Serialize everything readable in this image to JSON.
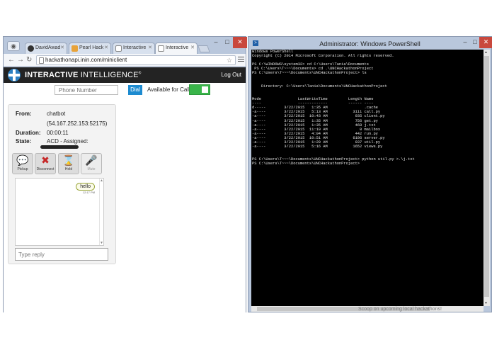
{
  "browser": {
    "tabs": [
      {
        "label": "DavidAwad",
        "color": "#333333"
      },
      {
        "label": "Pearl Hack",
        "color": "#e8a33a"
      },
      {
        "label": "Interactive",
        "color": "#888888"
      },
      {
        "label": "Interactive",
        "color": "#888888"
      }
    ],
    "url": "hackathonapi.inin.com/miniclient",
    "min_glyph": "–",
    "max_glyph": "□",
    "close_glyph": "✕"
  },
  "site": {
    "brand_bold": "INTERACTIVE",
    "brand_rest": " INTELLIGENCE",
    "brand_mark": "®",
    "logout": "Log Out",
    "phone_placeholder": "Phone Number",
    "dial": "Dial",
    "available": "Available for Calls",
    "call": {
      "from_label": "From:",
      "from_value": "chatbot",
      "from_ip": "(54.167.252.153:52175)",
      "duration_label": "Duration:",
      "duration_value": "00:00:11",
      "state_label": "State:",
      "state_value": "ACD - Assigned:"
    },
    "actions": [
      {
        "label": "Pickup",
        "glyph": "💬"
      },
      {
        "label": "Disconnect",
        "glyph": "✖"
      },
      {
        "label": "Hold",
        "glyph": "⌛"
      },
      {
        "label": "Mute",
        "glyph": "🎤"
      }
    ],
    "chat": {
      "message": "hello",
      "time": "12:17 PM"
    },
    "reply_placeholder": "Type reply"
  },
  "powershell": {
    "title": "Administrator: Windows PowerShell",
    "console_text": "Windows PowerShell\nCopyright (C) 2014 Microsoft Corporation. All rights reserved.\n\nPS C:\\WINDOWS\\system32> cd C:\\Users\\Tania\\Documents\n PS C:\\Users\\T~~~\\Documents> cd .\\UNCHackathonProject\nPS C:\\Users\\T~~~\\Documents\\UNCHackathonProject> ls\n\n\n    Directory: C:\\Users\\Tania\\Documents\\UNCHackathonProject\n\n\nMode                LastWriteTime         Length Name\n----                -------------         ------ ----\nd-----        3/22/2015   1:35 AM                .cache\n-a----        3/22/2015   5:13 AM           3111 call.py\n-a----        3/22/2015  10:43 AM            935 client.py\n-a----        3/22/2015   1:35 AM            756 get.py\n-a----        3/22/2015   1:35 AM            468 j.txt\n-a----        3/22/2015  11:19 AM              0 mailbox\n-a----        3/22/2015   4:04 AM            442 run.py\n-a----        3/22/2015  10:51 AM           6106 server.py\n-a----        3/22/2015   1:29 AM            937 util.py\n-a----        3/22/2015   5:16 AM           1652 views.py\n\n\nPS C:\\Users\\T~~~\\Documents\\UNCHackathonProject> python util.py >.\\j.txt\nPS C:\\Users\\T~~~\\Documents\\UNCHackathonProject>",
    "tail_text": "Scoop on upcoming local hackathons!"
  }
}
